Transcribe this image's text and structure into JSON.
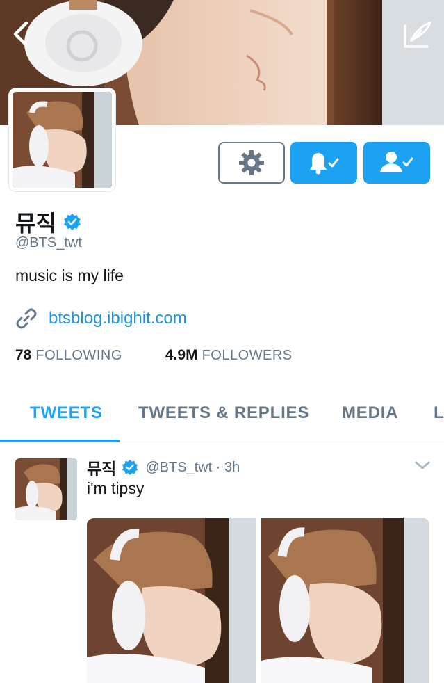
{
  "profile": {
    "name": "뮤직",
    "handle": "@BTS_twt",
    "bio": "music is my life",
    "website": "btsblog.ibighit.com",
    "following_count": "78",
    "following_label": "FOLLOWING",
    "followers_count": "4.9M",
    "followers_label": "FOLLOWERS"
  },
  "tabs": [
    {
      "label": "TWEETS",
      "active": true
    },
    {
      "label": "TWEETS & REPLIES",
      "active": false
    },
    {
      "label": "MEDIA",
      "active": false
    },
    {
      "label": "L",
      "active": false
    }
  ],
  "tweet": {
    "name": "뮤직",
    "meta": "@BTS_twt · 3h",
    "text": "i'm tipsy"
  },
  "icons": {
    "back": "back-chevron-icon",
    "compose": "compose-icon",
    "settings": "gear-icon",
    "notifications": "bell-check-icon",
    "following": "user-check-icon",
    "verified": "verified-badge-icon",
    "link": "link-icon",
    "more": "chevron-down-icon"
  },
  "colors": {
    "accent": "#1da1f2",
    "link": "#1b95e0",
    "muted": "#657786",
    "text": "#14171a"
  }
}
